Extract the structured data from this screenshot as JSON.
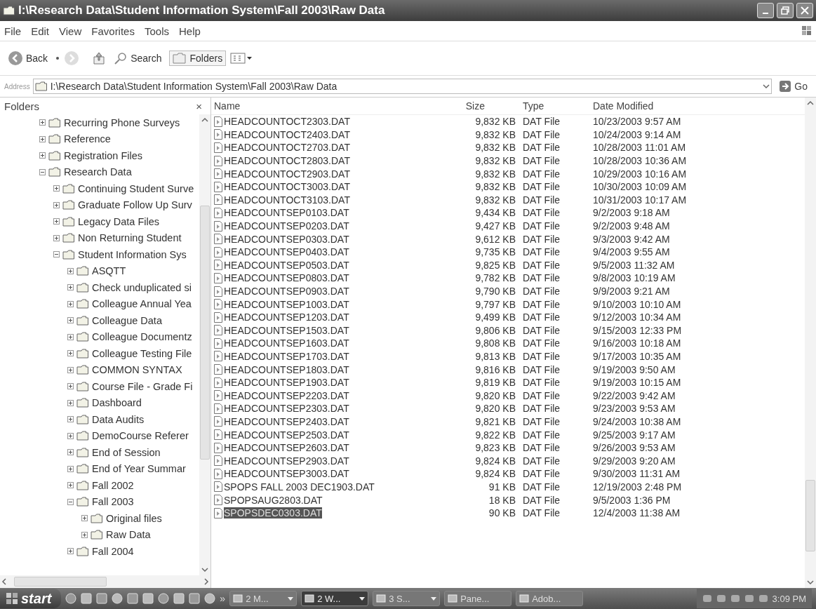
{
  "window": {
    "title": "I:\\Research Data\\Student Information System\\Fall 2003\\Raw Data"
  },
  "menu": [
    "File",
    "Edit",
    "View",
    "Favorites",
    "Tools",
    "Help"
  ],
  "toolbar": {
    "back": "Back",
    "search": "Search",
    "folders": "Folders"
  },
  "address": {
    "label": "Address",
    "value": "I:\\Research Data\\Student Information System\\Fall 2003\\Raw Data",
    "go": "Go"
  },
  "folders": {
    "title": "Folders",
    "close": "×",
    "items": [
      {
        "label": "Recurring Phone Surveys",
        "expanded": false
      },
      {
        "label": "Reference",
        "expanded": false
      },
      {
        "label": "Registration Files",
        "expanded": false
      },
      {
        "label": "Research Data",
        "expanded": true,
        "children": [
          {
            "label": "Continuing Student Surve",
            "expanded": false
          },
          {
            "label": "Graduate Follow Up Surv",
            "expanded": false
          },
          {
            "label": "Legacy Data Files",
            "expanded": false
          },
          {
            "label": "Non Returning Student",
            "expanded": false
          },
          {
            "label": "Student Information Sys",
            "expanded": true,
            "children": [
              {
                "label": "ASQTT",
                "expanded": false
              },
              {
                "label": "Check unduplicated si",
                "expanded": false
              },
              {
                "label": "Colleague Annual Yea",
                "expanded": false
              },
              {
                "label": "Colleague Data",
                "expanded": false
              },
              {
                "label": "Colleague Documentz",
                "expanded": false
              },
              {
                "label": "Colleague Testing File",
                "expanded": false
              },
              {
                "label": "COMMON SYNTAX",
                "expanded": false
              },
              {
                "label": "Course File - Grade Fi",
                "expanded": false
              },
              {
                "label": "Dashboard",
                "expanded": false
              },
              {
                "label": "Data Audits",
                "expanded": false
              },
              {
                "label": "DemoCourse Referer",
                "expanded": false
              },
              {
                "label": "End of Session",
                "expanded": false
              },
              {
                "label": "End of Year Summar",
                "expanded": false
              },
              {
                "label": "Fall 2002",
                "expanded": false
              },
              {
                "label": "Fall 2003",
                "expanded": true,
                "children": [
                  {
                    "label": "Original files",
                    "expanded": false
                  },
                  {
                    "label": "Raw Data",
                    "expanded": false
                  }
                ]
              },
              {
                "label": "Fall 2004",
                "expanded": false
              }
            ]
          }
        ]
      }
    ]
  },
  "table": {
    "columns": [
      "Name",
      "Size",
      "Type",
      "Date Modified"
    ],
    "rows": [
      {
        "name": "HEADCOUNTOCT2303.DAT",
        "size": "9,832 KB",
        "type": "DAT File",
        "date": "10/23/2003 9:57 AM",
        "selected": false
      },
      {
        "name": "HEADCOUNTOCT2403.DAT",
        "size": "9,832 KB",
        "type": "DAT File",
        "date": "10/24/2003 9:14 AM",
        "selected": false
      },
      {
        "name": "HEADCOUNTOCT2703.DAT",
        "size": "9,832 KB",
        "type": "DAT File",
        "date": "10/28/2003 11:01 AM",
        "selected": false
      },
      {
        "name": "HEADCOUNTOCT2803.DAT",
        "size": "9,832 KB",
        "type": "DAT File",
        "date": "10/28/2003 10:36 AM",
        "selected": false
      },
      {
        "name": "HEADCOUNTOCT2903.DAT",
        "size": "9,832 KB",
        "type": "DAT File",
        "date": "10/29/2003 10:16 AM",
        "selected": false
      },
      {
        "name": "HEADCOUNTOCT3003.DAT",
        "size": "9,832 KB",
        "type": "DAT File",
        "date": "10/30/2003 10:09 AM",
        "selected": false
      },
      {
        "name": "HEADCOUNTOCT3103.DAT",
        "size": "9,832 KB",
        "type": "DAT File",
        "date": "10/31/2003 10:17 AM",
        "selected": false
      },
      {
        "name": "HEADCOUNTSEP0103.DAT",
        "size": "9,434 KB",
        "type": "DAT File",
        "date": "9/2/2003 9:18 AM",
        "selected": false
      },
      {
        "name": "HEADCOUNTSEP0203.DAT",
        "size": "9,427 KB",
        "type": "DAT File",
        "date": "9/2/2003 9:48 AM",
        "selected": false
      },
      {
        "name": "HEADCOUNTSEP0303.DAT",
        "size": "9,612 KB",
        "type": "DAT File",
        "date": "9/3/2003 9:42 AM",
        "selected": false
      },
      {
        "name": "HEADCOUNTSEP0403.DAT",
        "size": "9,735 KB",
        "type": "DAT File",
        "date": "9/4/2003 9:55 AM",
        "selected": false
      },
      {
        "name": "HEADCOUNTSEP0503.DAT",
        "size": "9,825 KB",
        "type": "DAT File",
        "date": "9/5/2003 11:32 AM",
        "selected": false
      },
      {
        "name": "HEADCOUNTSEP0803.DAT",
        "size": "9,782 KB",
        "type": "DAT File",
        "date": "9/8/2003 10:19 AM",
        "selected": false
      },
      {
        "name": "HEADCOUNTSEP0903.DAT",
        "size": "9,790 KB",
        "type": "DAT File",
        "date": "9/9/2003 9:21 AM",
        "selected": false
      },
      {
        "name": "HEADCOUNTSEP1003.DAT",
        "size": "9,797 KB",
        "type": "DAT File",
        "date": "9/10/2003 10:10 AM",
        "selected": false
      },
      {
        "name": "HEADCOUNTSEP1203.DAT",
        "size": "9,499 KB",
        "type": "DAT File",
        "date": "9/12/2003 10:34 AM",
        "selected": false
      },
      {
        "name": "HEADCOUNTSEP1503.DAT",
        "size": "9,806 KB",
        "type": "DAT File",
        "date": "9/15/2003 12:33 PM",
        "selected": false
      },
      {
        "name": "HEADCOUNTSEP1603.DAT",
        "size": "9,808 KB",
        "type": "DAT File",
        "date": "9/16/2003 10:18 AM",
        "selected": false
      },
      {
        "name": "HEADCOUNTSEP1703.DAT",
        "size": "9,813 KB",
        "type": "DAT File",
        "date": "9/17/2003 10:35 AM",
        "selected": false
      },
      {
        "name": "HEADCOUNTSEP1803.DAT",
        "size": "9,816 KB",
        "type": "DAT File",
        "date": "9/19/2003 9:50 AM",
        "selected": false
      },
      {
        "name": "HEADCOUNTSEP1903.DAT",
        "size": "9,819 KB",
        "type": "DAT File",
        "date": "9/19/2003 10:15 AM",
        "selected": false
      },
      {
        "name": "HEADCOUNTSEP2203.DAT",
        "size": "9,820 KB",
        "type": "DAT File",
        "date": "9/22/2003 9:42 AM",
        "selected": false
      },
      {
        "name": "HEADCOUNTSEP2303.DAT",
        "size": "9,820 KB",
        "type": "DAT File",
        "date": "9/23/2003 9:53 AM",
        "selected": false
      },
      {
        "name": "HEADCOUNTSEP2403.DAT",
        "size": "9,821 KB",
        "type": "DAT File",
        "date": "9/24/2003 10:38 AM",
        "selected": false
      },
      {
        "name": "HEADCOUNTSEP2503.DAT",
        "size": "9,822 KB",
        "type": "DAT File",
        "date": "9/25/2003 9:17 AM",
        "selected": false
      },
      {
        "name": "HEADCOUNTSEP2603.DAT",
        "size": "9,823 KB",
        "type": "DAT File",
        "date": "9/26/2003 9:53 AM",
        "selected": false
      },
      {
        "name": "HEADCOUNTSEP2903.DAT",
        "size": "9,824 KB",
        "type": "DAT File",
        "date": "9/29/2003 9:20 AM",
        "selected": false
      },
      {
        "name": "HEADCOUNTSEP3003.DAT",
        "size": "9,824 KB",
        "type": "DAT File",
        "date": "9/30/2003 11:31 AM",
        "selected": false
      },
      {
        "name": "SPOPS FALL 2003 DEC1903.DAT",
        "size": "91 KB",
        "type": "DAT File",
        "date": "12/19/2003 2:48 PM",
        "selected": false
      },
      {
        "name": "SPOPSAUG2803.DAT",
        "size": "18 KB",
        "type": "DAT File",
        "date": "9/5/2003 1:36 PM",
        "selected": false
      },
      {
        "name": "SPOPSDEC0303.DAT",
        "size": "90 KB",
        "type": "DAT File",
        "date": "12/4/2003 11:38 AM",
        "selected": true
      }
    ]
  },
  "taskbar": {
    "start": "start",
    "more": "»",
    "tasks": [
      {
        "label": "2 M...",
        "group": true,
        "selected": false
      },
      {
        "label": "2 W...",
        "group": true,
        "selected": true
      },
      {
        "label": "3 S...",
        "group": true,
        "selected": false
      },
      {
        "label": "Pane...",
        "group": false,
        "selected": false
      },
      {
        "label": "Adob...",
        "group": false,
        "selected": false
      }
    ],
    "clock": "3:09 PM"
  }
}
